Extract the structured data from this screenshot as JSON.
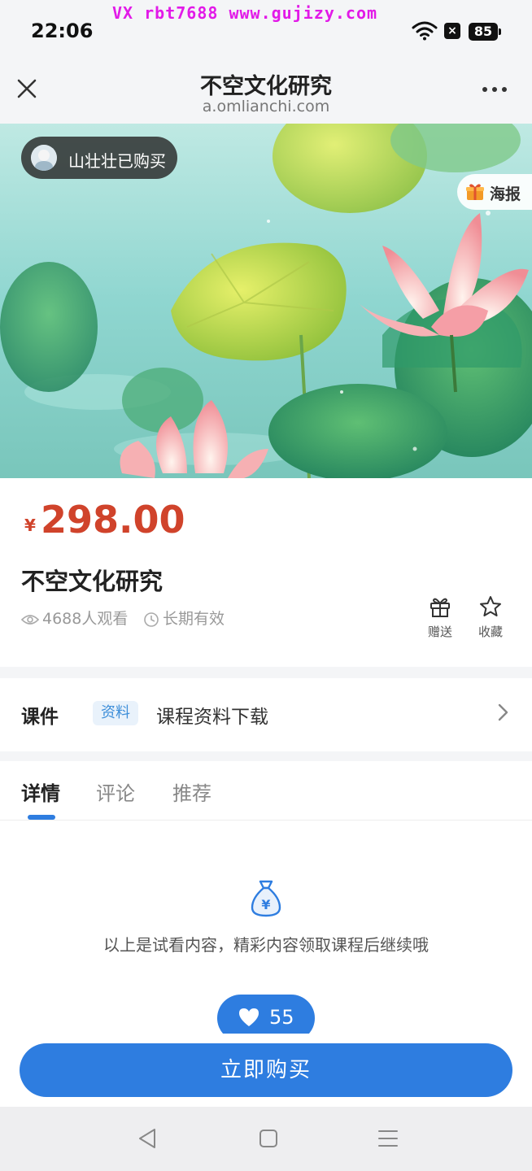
{
  "status_bar": {
    "time": "22:06",
    "watermark": "VX rbt7688  www.gujizy.com",
    "battery": "85"
  },
  "header": {
    "title": "不空文化研究",
    "domain": "a.omlianchi.com"
  },
  "banner": {
    "buyer_notice": "山壮壮已购买",
    "poster_label": "海报"
  },
  "product": {
    "currency": "¥",
    "price": "298.00",
    "title": "不空文化研究",
    "views": "4688人观看",
    "validity": "长期有效",
    "gift_label": "赠送",
    "favorite_label": "收藏"
  },
  "courseware": {
    "label": "课件",
    "tag": "资料",
    "link": "课程资料下载"
  },
  "tabs": [
    "详情",
    "评论",
    "推荐"
  ],
  "detail": {
    "trial_notice": "以上是试看内容，精彩内容领取课程后继续哦",
    "likes": "55"
  },
  "buy_button": "立即购买",
  "colors": {
    "accent": "#2e7de0",
    "price": "#d0432b",
    "watermark": "#e21ae8"
  }
}
